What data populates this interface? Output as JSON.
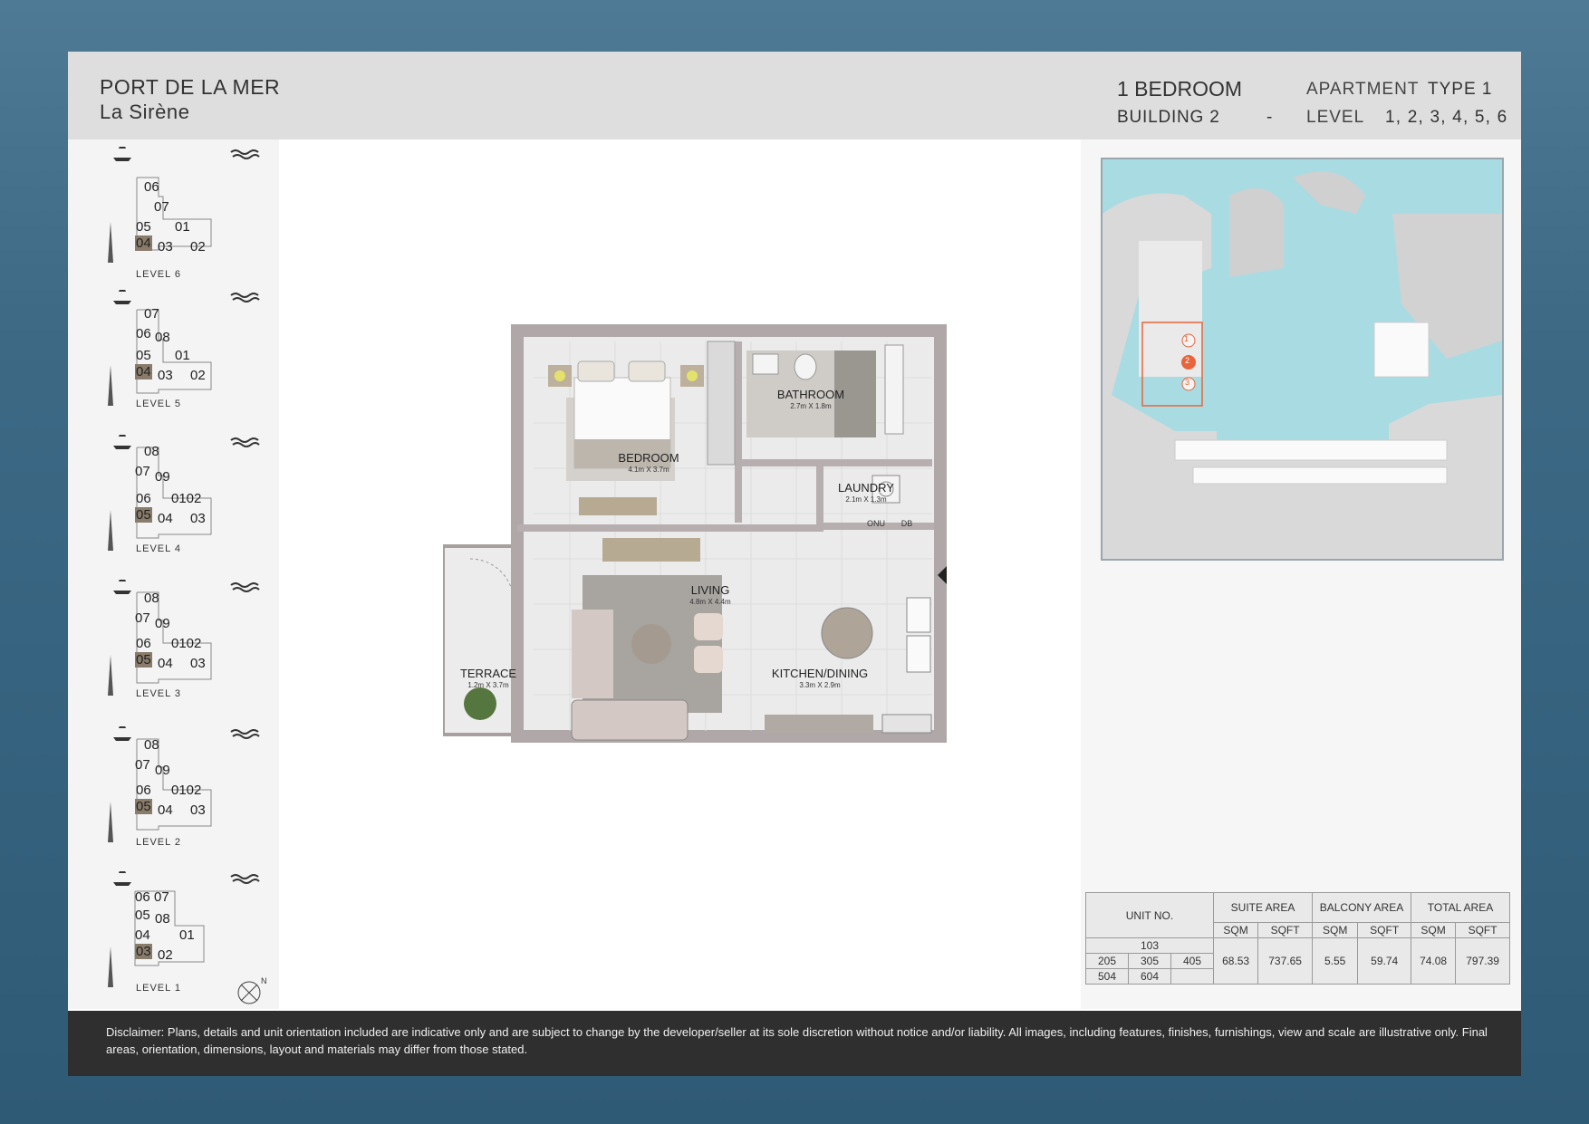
{
  "header": {
    "project": "PORT DE LA MER",
    "subproject": "La Sirène",
    "bedrooms": "1 BEDROOM",
    "apartment_label": "APARTMENT",
    "type": "TYPE 1",
    "building": "BUILDING 2",
    "dash": "-",
    "level_label": "LEVEL",
    "levels": "1, 2, 3, 4, 5, 6"
  },
  "levels": [
    {
      "label": "LEVEL 6",
      "units": [
        "06",
        "07",
        "05",
        "01",
        "04",
        "03",
        "02"
      ],
      "highlight": "04"
    },
    {
      "label": "LEVEL 5",
      "units": [
        "07",
        "06",
        "08",
        "05",
        "01",
        "04",
        "03",
        "02"
      ],
      "highlight": "04"
    },
    {
      "label": "LEVEL 4",
      "units": [
        "08",
        "07",
        "09",
        "06",
        "0102",
        "05",
        "04",
        "03"
      ],
      "highlight": "05"
    },
    {
      "label": "LEVEL 3",
      "units": [
        "08",
        "07",
        "09",
        "06",
        "0102",
        "05",
        "04",
        "03"
      ],
      "highlight": "05"
    },
    {
      "label": "LEVEL 2",
      "units": [
        "08",
        "07",
        "09",
        "06",
        "0102",
        "05",
        "04",
        "03"
      ],
      "highlight": "05"
    },
    {
      "label": "LEVEL 1",
      "units": [
        "06",
        "07",
        "05",
        "08",
        "04",
        "01",
        "03",
        "02"
      ],
      "highlight": "03"
    }
  ],
  "compass": "N",
  "rooms": {
    "bedroom": {
      "name": "BEDROOM",
      "dim": "4.1m X 3.7m"
    },
    "bathroom": {
      "name": "BATHROOM",
      "dim": "2.7m X 1.8m"
    },
    "laundry": {
      "name": "LAUNDRY",
      "dim": "2.1m X 1.3m"
    },
    "living": {
      "name": "LIVING",
      "dim": "4.8m X 4.4m"
    },
    "kitchen": {
      "name": "KITCHEN/DINING",
      "dim": "3.3m X 2.9m"
    },
    "terrace": {
      "name": "TERRACE",
      "dim": "1.2m X 3.7m"
    },
    "onu": "ONU",
    "db": "DB"
  },
  "keyplan": {
    "markers": [
      "1",
      "2",
      "3"
    ],
    "highlight_color": "#e8643a",
    "water_color": "#a9dbe2"
  },
  "areas": {
    "unit_header": "UNIT NO.",
    "suite_header": "SUITE AREA",
    "balcony_header": "BALCONY AREA",
    "total_header": "TOTAL AREA",
    "sqm": "SQM",
    "sqft": "SQFT",
    "units_row1": [
      "103"
    ],
    "units_row2": [
      "205",
      "305",
      "405"
    ],
    "units_row3": [
      "504",
      "604"
    ],
    "suite_sqm": "68.53",
    "suite_sqft": "737.65",
    "balcony_sqm": "5.55",
    "balcony_sqft": "59.74",
    "total_sqm": "74.08",
    "total_sqft": "797.39"
  },
  "disclaimer": "Disclaimer: Plans, details and unit orientation included are indicative only and are subject to change by the developer/seller at its sole discretion without notice and/or liability. All images, including features, finishes, furnishings, view and scale are illustrative only. Final areas, orientation, dimensions, layout and materials may differ from those stated."
}
